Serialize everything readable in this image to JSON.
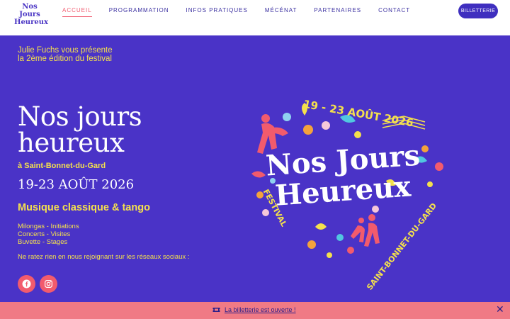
{
  "logo": {
    "line1": "Nos Jours",
    "line2": "Heureux"
  },
  "nav": {
    "items": [
      {
        "label": "ACCUEIL",
        "active": true
      },
      {
        "label": "PROGRAMMATION"
      },
      {
        "label": "INFOS PRATIQUES"
      },
      {
        "label": "MÉCÉNAT"
      },
      {
        "label": "PARTENAIRES"
      },
      {
        "label": "CONTACT"
      }
    ],
    "ticket_button": "BILLETTERIE"
  },
  "hero": {
    "presents_line1": "Julie Fuchs vous présente",
    "presents_line2": "la 2ème édition du festival",
    "title_line1": "Nos jours",
    "title_line2": "heureux",
    "place": "à Saint-Bonnet-du-Gard",
    "dates": "19-23 AOÛT 2026",
    "tagline": "Musique classique & tango",
    "activities": [
      "Milongas - Initiations",
      "Concerts - Visites",
      "Buvette - Stages"
    ],
    "social_text": "Ne ratez rien en nous rejoignant sur les réseaux sociaux :",
    "social_icons": [
      "facebook-icon",
      "instagram-icon"
    ]
  },
  "poster": {
    "dates": "19 - 23 AOÛT 2026",
    "title_line1": "Nos Jours",
    "title_line2": "Heureux",
    "festival": "FESTIVAL",
    "place": "SAINT-BONNET-DU-GARD"
  },
  "banner": {
    "icon": "ticket-icon",
    "link": "La billetterie est ouverte !",
    "close_icon": "close-icon"
  },
  "colors": {
    "brand_purple": "#4a33c7",
    "accent_yellow": "#f4e04d",
    "accent_pink": "#f25b6d",
    "banner_pink": "#f07a85"
  }
}
